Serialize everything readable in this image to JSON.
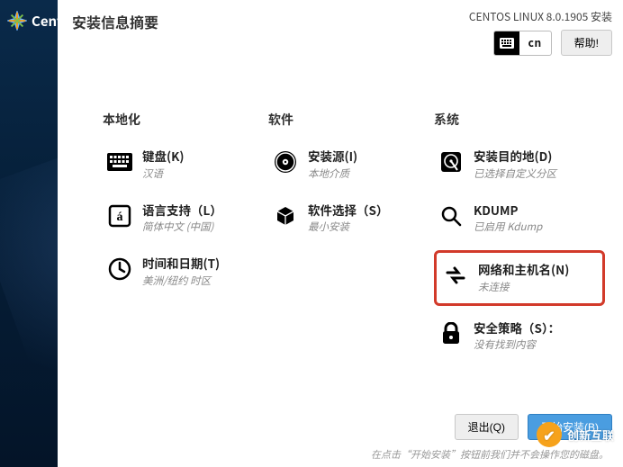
{
  "brand": "CentOS",
  "header": {
    "title": "安装信息摘要",
    "release": "CENTOS LINUX 8.0.1905 安装",
    "keyboard_indicator": "cn",
    "help_label": "帮助!"
  },
  "categories": {
    "localization": {
      "title": "本地化",
      "spokes": {
        "keyboard": {
          "title": "键盘(K)",
          "status": "汉语"
        },
        "language": {
          "title": "语言支持（L）",
          "status": "简体中文 (中国)"
        },
        "datetime": {
          "title": "时间和日期(T)",
          "status": "美洲/纽约 时区"
        }
      }
    },
    "software": {
      "title": "软件",
      "spokes": {
        "source": {
          "title": "安装源(I)",
          "status": "本地介质"
        },
        "selection": {
          "title": "软件选择（S）",
          "status": "最小安装"
        }
      }
    },
    "system": {
      "title": "系统",
      "spokes": {
        "destination": {
          "title": "安装目的地(D)",
          "status": "已选择自定义分区"
        },
        "kdump": {
          "title": "KDUMP",
          "status": "已启用 Kdump"
        },
        "network": {
          "title": "网络和主机名(N)",
          "status": "未连接"
        },
        "security": {
          "title": "安全策略（S）：",
          "status": "没有找到内容"
        }
      }
    }
  },
  "footer": {
    "quit_label": "退出(Q)",
    "begin_label": "开始安装(B)",
    "hint": "在点击“开始安装”按钮前我们并不会操作您的磁盘。"
  },
  "watermark": "创新互联"
}
